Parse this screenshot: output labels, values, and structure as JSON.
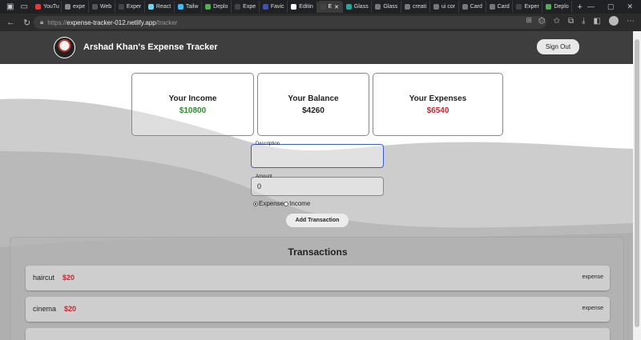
{
  "browser": {
    "tabs": [
      {
        "label": "YouTu",
        "color": "#e53935"
      },
      {
        "label": "expe",
        "color": "#888888"
      },
      {
        "label": "Web",
        "color": "#555555"
      },
      {
        "label": "Exper",
        "color": "#444444"
      },
      {
        "label": "React",
        "color": "#61dafb"
      },
      {
        "label": "Tailw",
        "color": "#38bdf8"
      },
      {
        "label": "Deplo",
        "color": "#4caf50"
      },
      {
        "label": "Expe",
        "color": "#444444"
      },
      {
        "label": "Favic",
        "color": "#3f51b5"
      },
      {
        "label": "Editin",
        "color": "#ffffff"
      },
      {
        "label": "E",
        "color": "#444444",
        "active": true
      },
      {
        "label": "Glass",
        "color": "#26a69a"
      },
      {
        "label": "Glass",
        "color": "#777777"
      },
      {
        "label": "creati",
        "color": "#777777"
      },
      {
        "label": "ui cor",
        "color": "#777777"
      },
      {
        "label": "Card",
        "color": "#777777"
      },
      {
        "label": "Card",
        "color": "#777777"
      },
      {
        "label": "Exper",
        "color": "#444444"
      },
      {
        "label": "Deplo",
        "color": "#4caf50"
      }
    ],
    "url_scheme": "https://",
    "url_host": "expense-tracker-012.netlify.app",
    "url_path": "/tracker"
  },
  "header": {
    "title": "Arshad Khan's Expense Tracker",
    "signout_label": "Sign Out"
  },
  "summary": {
    "income_label": "Your Income",
    "income_value": "$10800",
    "balance_label": "Your Balance",
    "balance_value": "$4260",
    "expenses_label": "Your Expenses",
    "expenses_value": "$6540"
  },
  "form": {
    "description_label": "Description",
    "description_value": "",
    "amount_label": "Amount",
    "amount_value": "0",
    "expense_option": "Expense",
    "income_option": "Income",
    "selected": "Expense",
    "submit_label": "Add Transaction"
  },
  "transactions": {
    "title": "Transactions",
    "items": [
      {
        "name": "haircut",
        "amount": "$20",
        "type": "expense"
      },
      {
        "name": "cinema",
        "amount": "$20",
        "type": "expense"
      }
    ]
  },
  "colors": {
    "income": "#2e8b2e",
    "expense": "#d0202a",
    "header_bg": "#3f3e3e"
  }
}
